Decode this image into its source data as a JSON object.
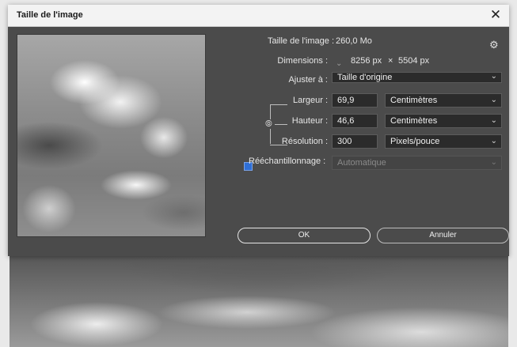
{
  "window": {
    "title": "Taille de l'image",
    "close_glyph": "✕"
  },
  "image_size": {
    "label": "Taille de l'image :",
    "value": "260,0 Mo"
  },
  "dimensions": {
    "label": "Dimensions :",
    "width": "8256 px",
    "separator": "×",
    "height": "5504 px"
  },
  "fit_to": {
    "label": "Ajuster à :",
    "value": "Taille d'origine"
  },
  "width": {
    "label": "Largeur :",
    "value": "69,9",
    "unit": "Centimètres"
  },
  "height": {
    "label": "Hauteur :",
    "value": "46,6",
    "unit": "Centimètres"
  },
  "resolution": {
    "label": "Résolution :",
    "value": "300",
    "unit": "Pixels/pouce"
  },
  "resample": {
    "label": "Rééchantillonnage :",
    "checked": true,
    "value": "Automatique"
  },
  "buttons": {
    "ok": "OK",
    "cancel": "Annuler"
  },
  "icons": {
    "gear": "gear-icon",
    "link": "link-icon",
    "chevron": "chevron-down-icon",
    "close": "close-icon"
  },
  "colors": {
    "dialog_bg": "#4b4b4b",
    "titlebar_bg": "#f3f3f3",
    "checkbox_accent": "#2f6fd6"
  }
}
